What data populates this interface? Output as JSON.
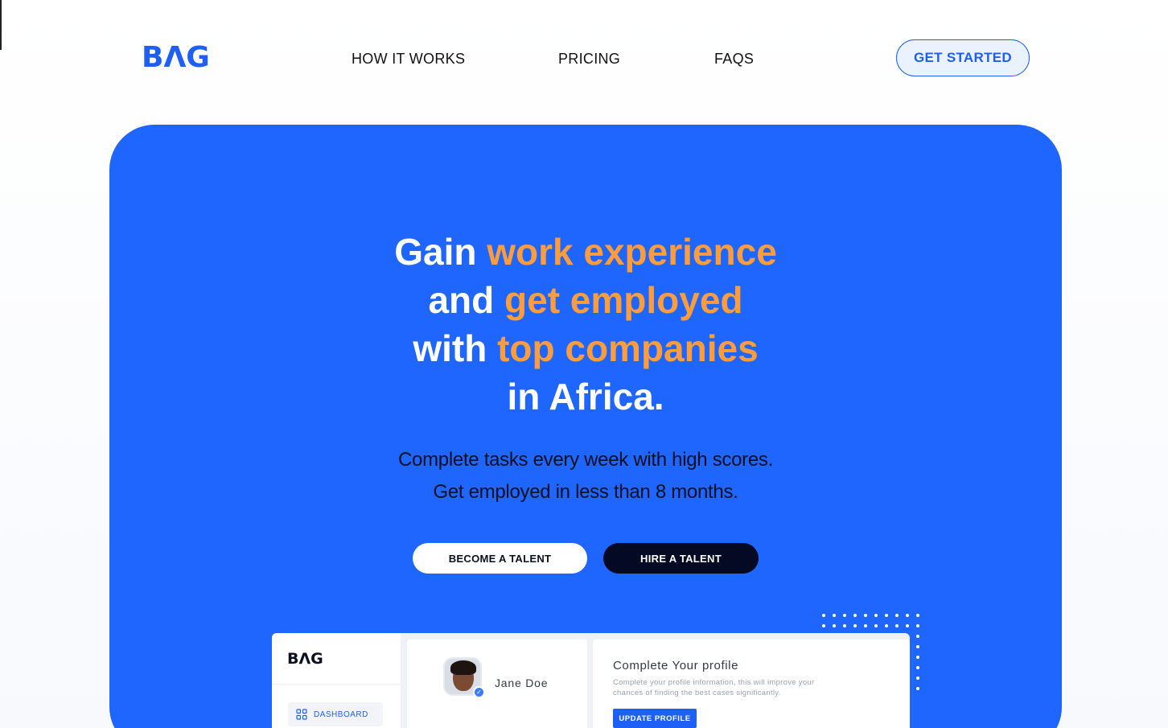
{
  "nav": {
    "logo": "BΛG",
    "links": [
      "HOW IT WORKS",
      "PRICING",
      "FAQS"
    ],
    "cta": "GET STARTED"
  },
  "hero": {
    "headline": {
      "line1_plain": "Gain",
      "line1_highlight": "work experience",
      "line2_plain": "and",
      "line2_highlight": "get employed",
      "line3_plain": "with",
      "line3_highlight": "top companies",
      "line4_plain": "in Africa."
    },
    "subtitle_line1": "Complete tasks every week with high scores.",
    "subtitle_line2": "Get employed in less than 8 months.",
    "primary_button": "BECOME A TALENT",
    "secondary_button": "HIRE A TALENT",
    "colors": {
      "background": "#1f66ff",
      "highlight": "#ff9d3c",
      "dark_button": "#050a24"
    }
  },
  "dashboard_preview": {
    "logo": "BΛG",
    "sidebar_item": "DASHBOARD",
    "user_name": "Jane Doe",
    "profile_title": "Complete Your profile",
    "profile_desc": "Complete your profile information, this will improve your chances of finding the best cases significantly.",
    "profile_button": "UPDATE PROFILE"
  }
}
